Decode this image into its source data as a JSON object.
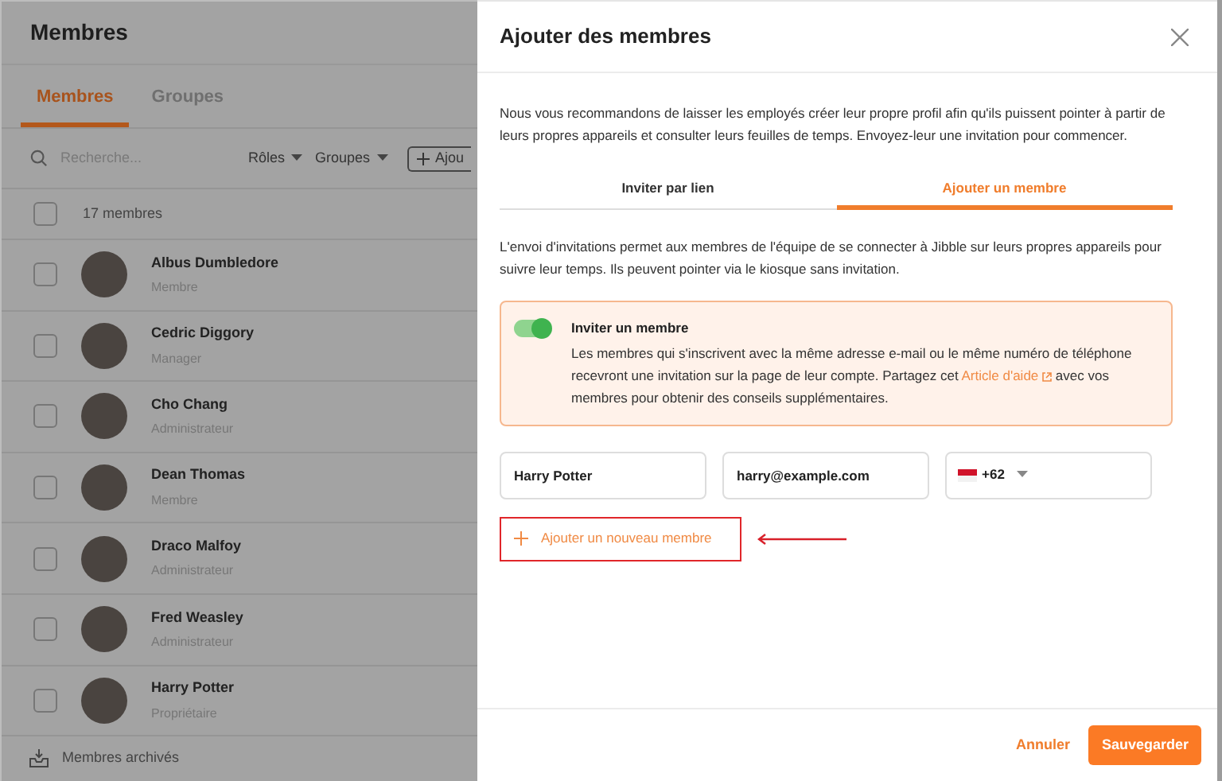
{
  "members_page": {
    "title": "Membres",
    "tabs": [
      {
        "label": "Membres",
        "selected": true
      },
      {
        "label": "Groupes",
        "selected": false
      }
    ],
    "search": {
      "placeholder": "Recherche..."
    },
    "filters": [
      "Rôles",
      "Groupes"
    ],
    "add_button": "Ajou",
    "count": {
      "label": "17 membres",
      "checked": false
    },
    "members": [
      {
        "name": "Albus Dumbledore",
        "role": "Membre",
        "checked": false
      },
      {
        "name": "Cedric Diggory",
        "role": "Manager",
        "checked": false
      },
      {
        "name": "Cho Chang",
        "role": "Administrateur",
        "checked": false
      },
      {
        "name": "Dean Thomas",
        "role": "Membre",
        "checked": false
      },
      {
        "name": "Draco Malfoy",
        "role": "Administrateur",
        "checked": false
      },
      {
        "name": "Fred Weasley",
        "role": "Administrateur",
        "checked": false
      },
      {
        "name": "Harry Potter",
        "role": "Propriétaire",
        "checked": false
      }
    ],
    "archived": "Membres archivés"
  },
  "drawer": {
    "title": "Ajouter des membres",
    "intro": "Nous vous recommandons de laisser les employés créer leur propre profil afin qu'ils puissent pointer à partir de leurs propres appareils et consulter leurs feuilles de temps. Envoyez-leur une invitation pour commencer.",
    "tabs": [
      {
        "label": "Inviter par lien",
        "selected": false
      },
      {
        "label": "Ajouter un membre",
        "selected": true
      }
    ],
    "description": "L'envoi d'invitations permet aux membres de l'équipe de se connecter à Jibble sur leurs propres appareils pour suivre leur temps. Ils peuvent pointer via le kiosque sans invitation.",
    "invite": {
      "on": true,
      "title": "Inviter un membre",
      "text_before": "Les membres qui s'inscrivent avec la même adresse e-mail ou le même numéro de téléphone recevront une invitation sur la page de leur compte. Partagez cet",
      "link": "Article d'aide",
      "text_after": "avec vos membres pour obtenir des conseils supplémentaires."
    },
    "form": {
      "name": "Harry Potter",
      "email": "harry@example.com",
      "dial_code": "+62"
    },
    "add_new": "Ajouter un nouveau membre",
    "cancel": "Annuler",
    "save": "Sauvegarder"
  }
}
